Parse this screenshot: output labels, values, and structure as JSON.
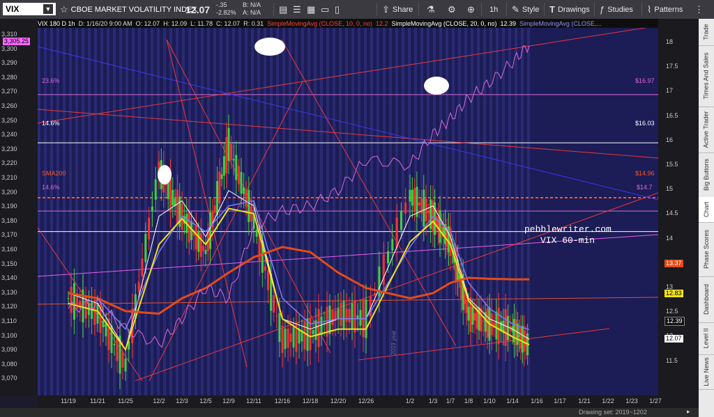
{
  "toolbar": {
    "symbol": "VIX",
    "symbol_name": "CBOE MARKET VOLATILITY INDEX",
    "price": "12.07",
    "change": "-.35",
    "change_pct": "-2.82%",
    "bid": "B: N/A",
    "ask": "A: N/A",
    "share_label": "Share",
    "interval_label": "1h",
    "style_label": "Style",
    "drawings_label": "Drawings",
    "studies_label": "Studies",
    "patterns_label": "Patterns"
  },
  "info_bar": {
    "title": "VIX 180 D 1h",
    "date": "D: 1/16/20 9:00 AM",
    "open": "O: 12.07",
    "high": "H: 12.09",
    "low": "L: 11.78",
    "close": "C: 12.07",
    "range": "R: 0.31",
    "study1": "SimpleMovingAvg (CLOSE, 10, 0, no)",
    "study1_val": "12.2",
    "study2": "SimpleMovingAvg (CLOSE, 20, 0, no)",
    "study2_val": "12.39",
    "study3": "SimpleMovingAvg (CLOSE,..."
  },
  "left_axis": {
    "ticks": [
      "3,310",
      "3,300",
      "3,290",
      "3,280",
      "3,270",
      "3,260",
      "3,250",
      "3,240",
      "3,230",
      "3,220",
      "3,210",
      "3,200",
      "3,190",
      "3,180",
      "3,170",
      "3,160",
      "3,150",
      "3,140",
      "3,130",
      "3,120",
      "3,110",
      "3,100",
      "3,090",
      "3,080",
      "3,070"
    ],
    "current": "3,305.25"
  },
  "right_axis": {
    "ticks": [
      "18",
      "17.5",
      "17",
      "16.5",
      "16",
      "15.5",
      "15",
      "14.5",
      "14",
      "13.5",
      "13",
      "12.5",
      "12",
      "11.5"
    ],
    "badges": [
      {
        "label": "13.37",
        "color": "#e64a19"
      },
      {
        "label": "12.83",
        "color": "#f1e21a"
      },
      {
        "label": "12.39",
        "color": "#ffffff"
      },
      {
        "label": "12.07",
        "color": "#ffffff"
      }
    ]
  },
  "x_axis": {
    "ticks": [
      "11/19",
      "11/21",
      "11/25",
      "12/2",
      "12/3",
      "12/5",
      "12/9",
      "12/11",
      "12/16",
      "12/18",
      "12/20",
      "12/26",
      "1/2",
      "1/3",
      "1/7",
      "1/8",
      "1/10",
      "1/14",
      "1/16",
      "1/17",
      "1/21",
      "1/22",
      "1/23",
      "1/27"
    ]
  },
  "levels": [
    {
      "left": "23.6%",
      "right": "$16.97",
      "color": "#d76bd9"
    },
    {
      "left": "14.6%",
      "right": "$16.03",
      "color": "#ffffff"
    },
    {
      "left": "SMA200",
      "right": "$14.96",
      "color": "#ff5722"
    },
    {
      "left": "14.6%",
      "right": "$14.7",
      "color": "#d76bd9"
    }
  ],
  "annotation": {
    "site": "pebblewriter.com",
    "subtitle": "VIX 60-min",
    "watermark": "2019 year"
  },
  "status": {
    "drawing_set": "Drawing set: 2019~1202"
  },
  "sidebar": {
    "tabs": [
      "Trade",
      "Times And Sales",
      "Active Trader",
      "Big Buttons",
      "Chart",
      "Phase Scores",
      "Dashboard",
      "Level II",
      "Live News"
    ]
  },
  "colors": {
    "chart_bg": "#1c1c56",
    "sma10": "#ffffff",
    "sma20": "#7b7bff",
    "sma_yellow": "#f1e21a",
    "sma200": "#e64a19",
    "spx_line": "#d76bd9"
  },
  "chart_data": {
    "type": "line",
    "x_categories": [
      "11/19",
      "11/21",
      "11/25",
      "12/2",
      "12/3",
      "12/5",
      "12/9",
      "12/11",
      "12/16",
      "12/18",
      "12/20",
      "12/26",
      "1/2",
      "1/3",
      "1/7",
      "1/8",
      "1/10",
      "1/14",
      "1/16"
    ],
    "series": [
      {
        "name": "VIX",
        "values": [
          13.0,
          12.7,
          11.7,
          15.5,
          14.6,
          13.9,
          16.0,
          14.5,
          12.2,
          12.3,
          12.7,
          12.6,
          15.0,
          14.6,
          14.1,
          12.7,
          12.5,
          12.4,
          12.07
        ]
      },
      {
        "name": "SimpleMovingAvg (CLOSE, 10, 0, no)",
        "values": [
          13.1,
          12.9,
          12.0,
          14.6,
          14.9,
          14.2,
          15.1,
          14.8,
          12.6,
          12.4,
          12.6,
          12.6,
          14.6,
          14.8,
          14.2,
          13.0,
          12.6,
          12.4,
          12.2
        ]
      },
      {
        "name": "SimpleMovingAvg (CLOSE, 20, 0, no)",
        "values": [
          13.1,
          13.0,
          12.4,
          13.9,
          14.6,
          14.3,
          14.8,
          14.9,
          13.0,
          12.5,
          12.6,
          12.6,
          14.0,
          14.6,
          14.3,
          13.3,
          12.8,
          12.5,
          12.39
        ]
      }
    ],
    "ylim_left": [
      3070,
      3312
    ],
    "ylim_right": [
      11.2,
      18.3
    ]
  }
}
